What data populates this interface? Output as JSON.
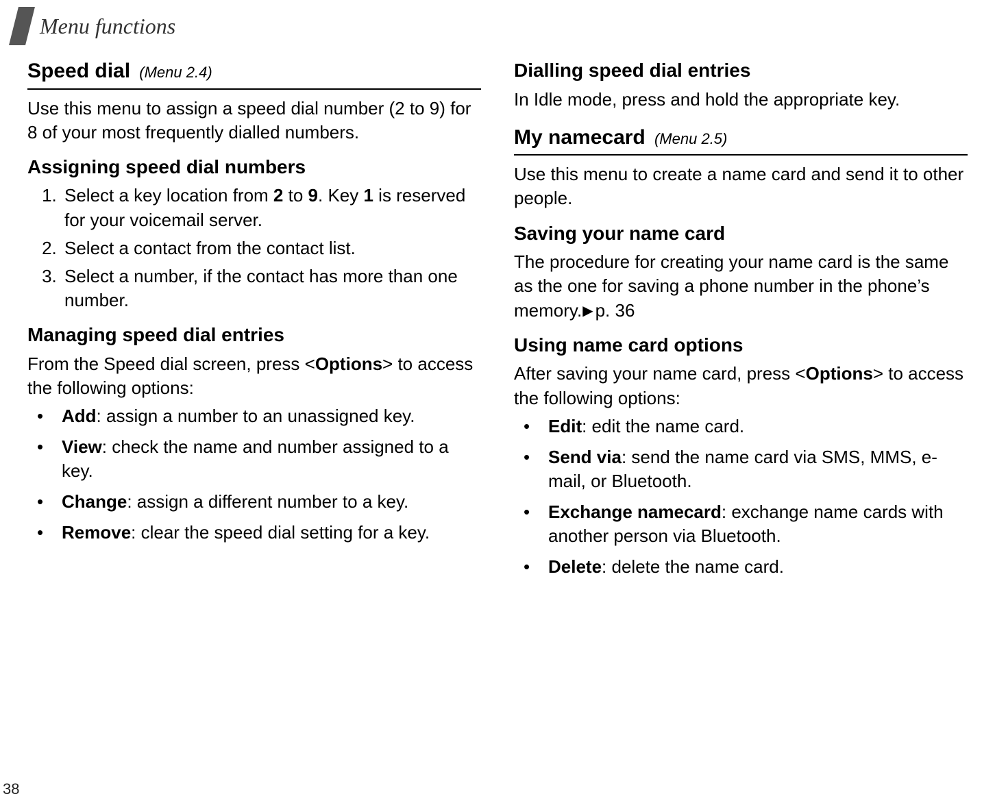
{
  "header": {
    "title": "Menu functions"
  },
  "left": {
    "speed_dial": {
      "title": "Speed dial",
      "menu_ref": "(Menu 2.4)",
      "intro": "Use this menu to assign a speed dial number (2 to 9) for 8 of your most frequently dialled numbers.",
      "assigning_head": "Assigning speed dial numbers",
      "steps": [
        {
          "pre": "Select a key location from ",
          "b1": "2",
          "mid1": " to ",
          "b2": "9",
          "mid2": ". Key ",
          "b3": "1",
          "post": " is reserved for your voicemail server."
        },
        {
          "text": "Select a contact from the contact list."
        },
        {
          "text": "Select a number, if the contact has more than one number."
        }
      ],
      "managing_head": "Managing speed dial entries",
      "managing_intro_pre": "From the Speed dial screen, press <",
      "managing_intro_bold": "Options",
      "managing_intro_post": "> to access the following options:",
      "opts": [
        {
          "b": "Add",
          "t": ": assign a number to an unassigned key."
        },
        {
          "b": "View",
          "t": ": check the name and number assigned to a key."
        },
        {
          "b": "Change",
          "t": ": assign a different number to a key."
        },
        {
          "b": "Remove",
          "t": ": clear the speed dial setting for a key."
        }
      ]
    }
  },
  "right": {
    "dialling_head": "Dialling speed dial entries",
    "dialling_text": "In Idle mode, press and hold the appropriate key.",
    "namecard": {
      "title": "My namecard",
      "menu_ref": "(Menu 2.5)",
      "intro": "Use this menu to create a name card and send it to other people.",
      "saving_head": "Saving your name card",
      "saving_text_pre": "The procedure for creating your name card is the same as the one for saving a phone number in the phone’s memory.",
      "saving_pageref": "p. 36",
      "using_head": "Using name card options",
      "using_intro_pre": "After saving your name card, press <",
      "using_intro_bold": "Options",
      "using_intro_post": "> to access the following options:",
      "opts": [
        {
          "b": "Edit",
          "t": ": edit the name card."
        },
        {
          "b": "Send via",
          "t": ": send the name card via SMS, MMS, e-mail, or Bluetooth."
        },
        {
          "b": "Exchange namecard",
          "t": ": exchange name cards with another person via Bluetooth."
        },
        {
          "b": "Delete",
          "t": ": delete the name card."
        }
      ]
    }
  },
  "page_number": "38",
  "glyphs": {
    "bullet": "•",
    "triangle": "▶"
  }
}
